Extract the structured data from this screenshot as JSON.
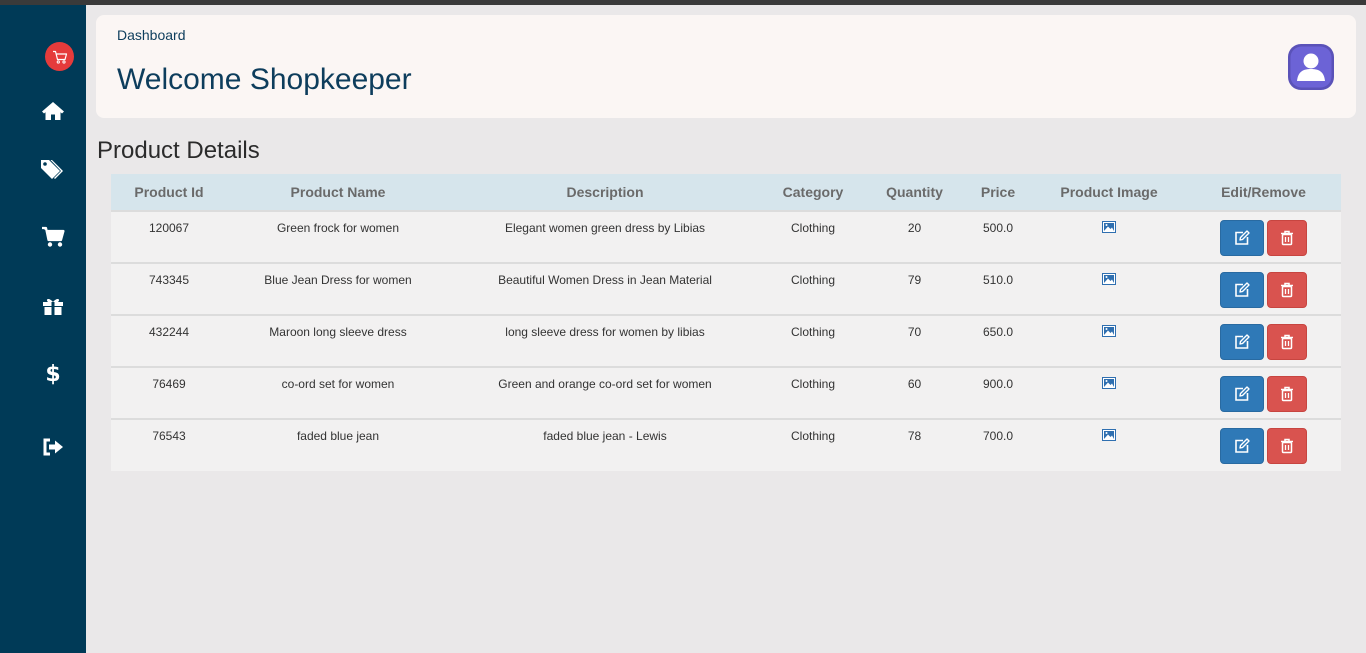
{
  "colors": {
    "sidebar": "#003a57",
    "accent": "#0d3d5c",
    "logo": "#e53b3b",
    "edit_button": "#2f79b7",
    "delete_button": "#d9534f",
    "table_header": "#d6e5ec"
  },
  "sidebar": {
    "logo_icon": "cart-icon",
    "items": [
      {
        "name": "home",
        "icon": "home-icon"
      },
      {
        "name": "tags",
        "icon": "tags-icon"
      },
      {
        "name": "cart",
        "icon": "cart-icon"
      },
      {
        "name": "gift",
        "icon": "gift-icon"
      },
      {
        "name": "dollar",
        "icon": "dollar-icon"
      },
      {
        "name": "logout",
        "icon": "sign-out-icon"
      }
    ]
  },
  "header": {
    "breadcrumb": "Dashboard",
    "welcome": "Welcome Shopkeeper",
    "avatar_icon": "user-avatar-icon"
  },
  "section_title": "Product Details",
  "table": {
    "columns": [
      "Product Id",
      "Product Name",
      "Description",
      "Category",
      "Quantity",
      "Price",
      "Product Image",
      "Edit/Remove"
    ],
    "rows": [
      {
        "id": "120067",
        "name": "Green frock for women",
        "description": "Elegant women green dress by Libias",
        "category": "Clothing",
        "quantity": "20",
        "price": "500.0"
      },
      {
        "id": "743345",
        "name": "Blue Jean Dress for women",
        "description": "Beautiful Women Dress in Jean Material",
        "category": "Clothing",
        "quantity": "79",
        "price": "510.0"
      },
      {
        "id": "432244",
        "name": "Maroon long sleeve dress",
        "description": "long sleeve dress for women by libias",
        "category": "Clothing",
        "quantity": "70",
        "price": "650.0"
      },
      {
        "id": "76469",
        "name": "co-ord set for women",
        "description": "Green and orange co-ord set for women",
        "category": "Clothing",
        "quantity": "60",
        "price": "900.0"
      },
      {
        "id": "76543",
        "name": "faded blue jean",
        "description": "faded blue jean - Lewis",
        "category": "Clothing",
        "quantity": "78",
        "price": "700.0"
      }
    ]
  }
}
